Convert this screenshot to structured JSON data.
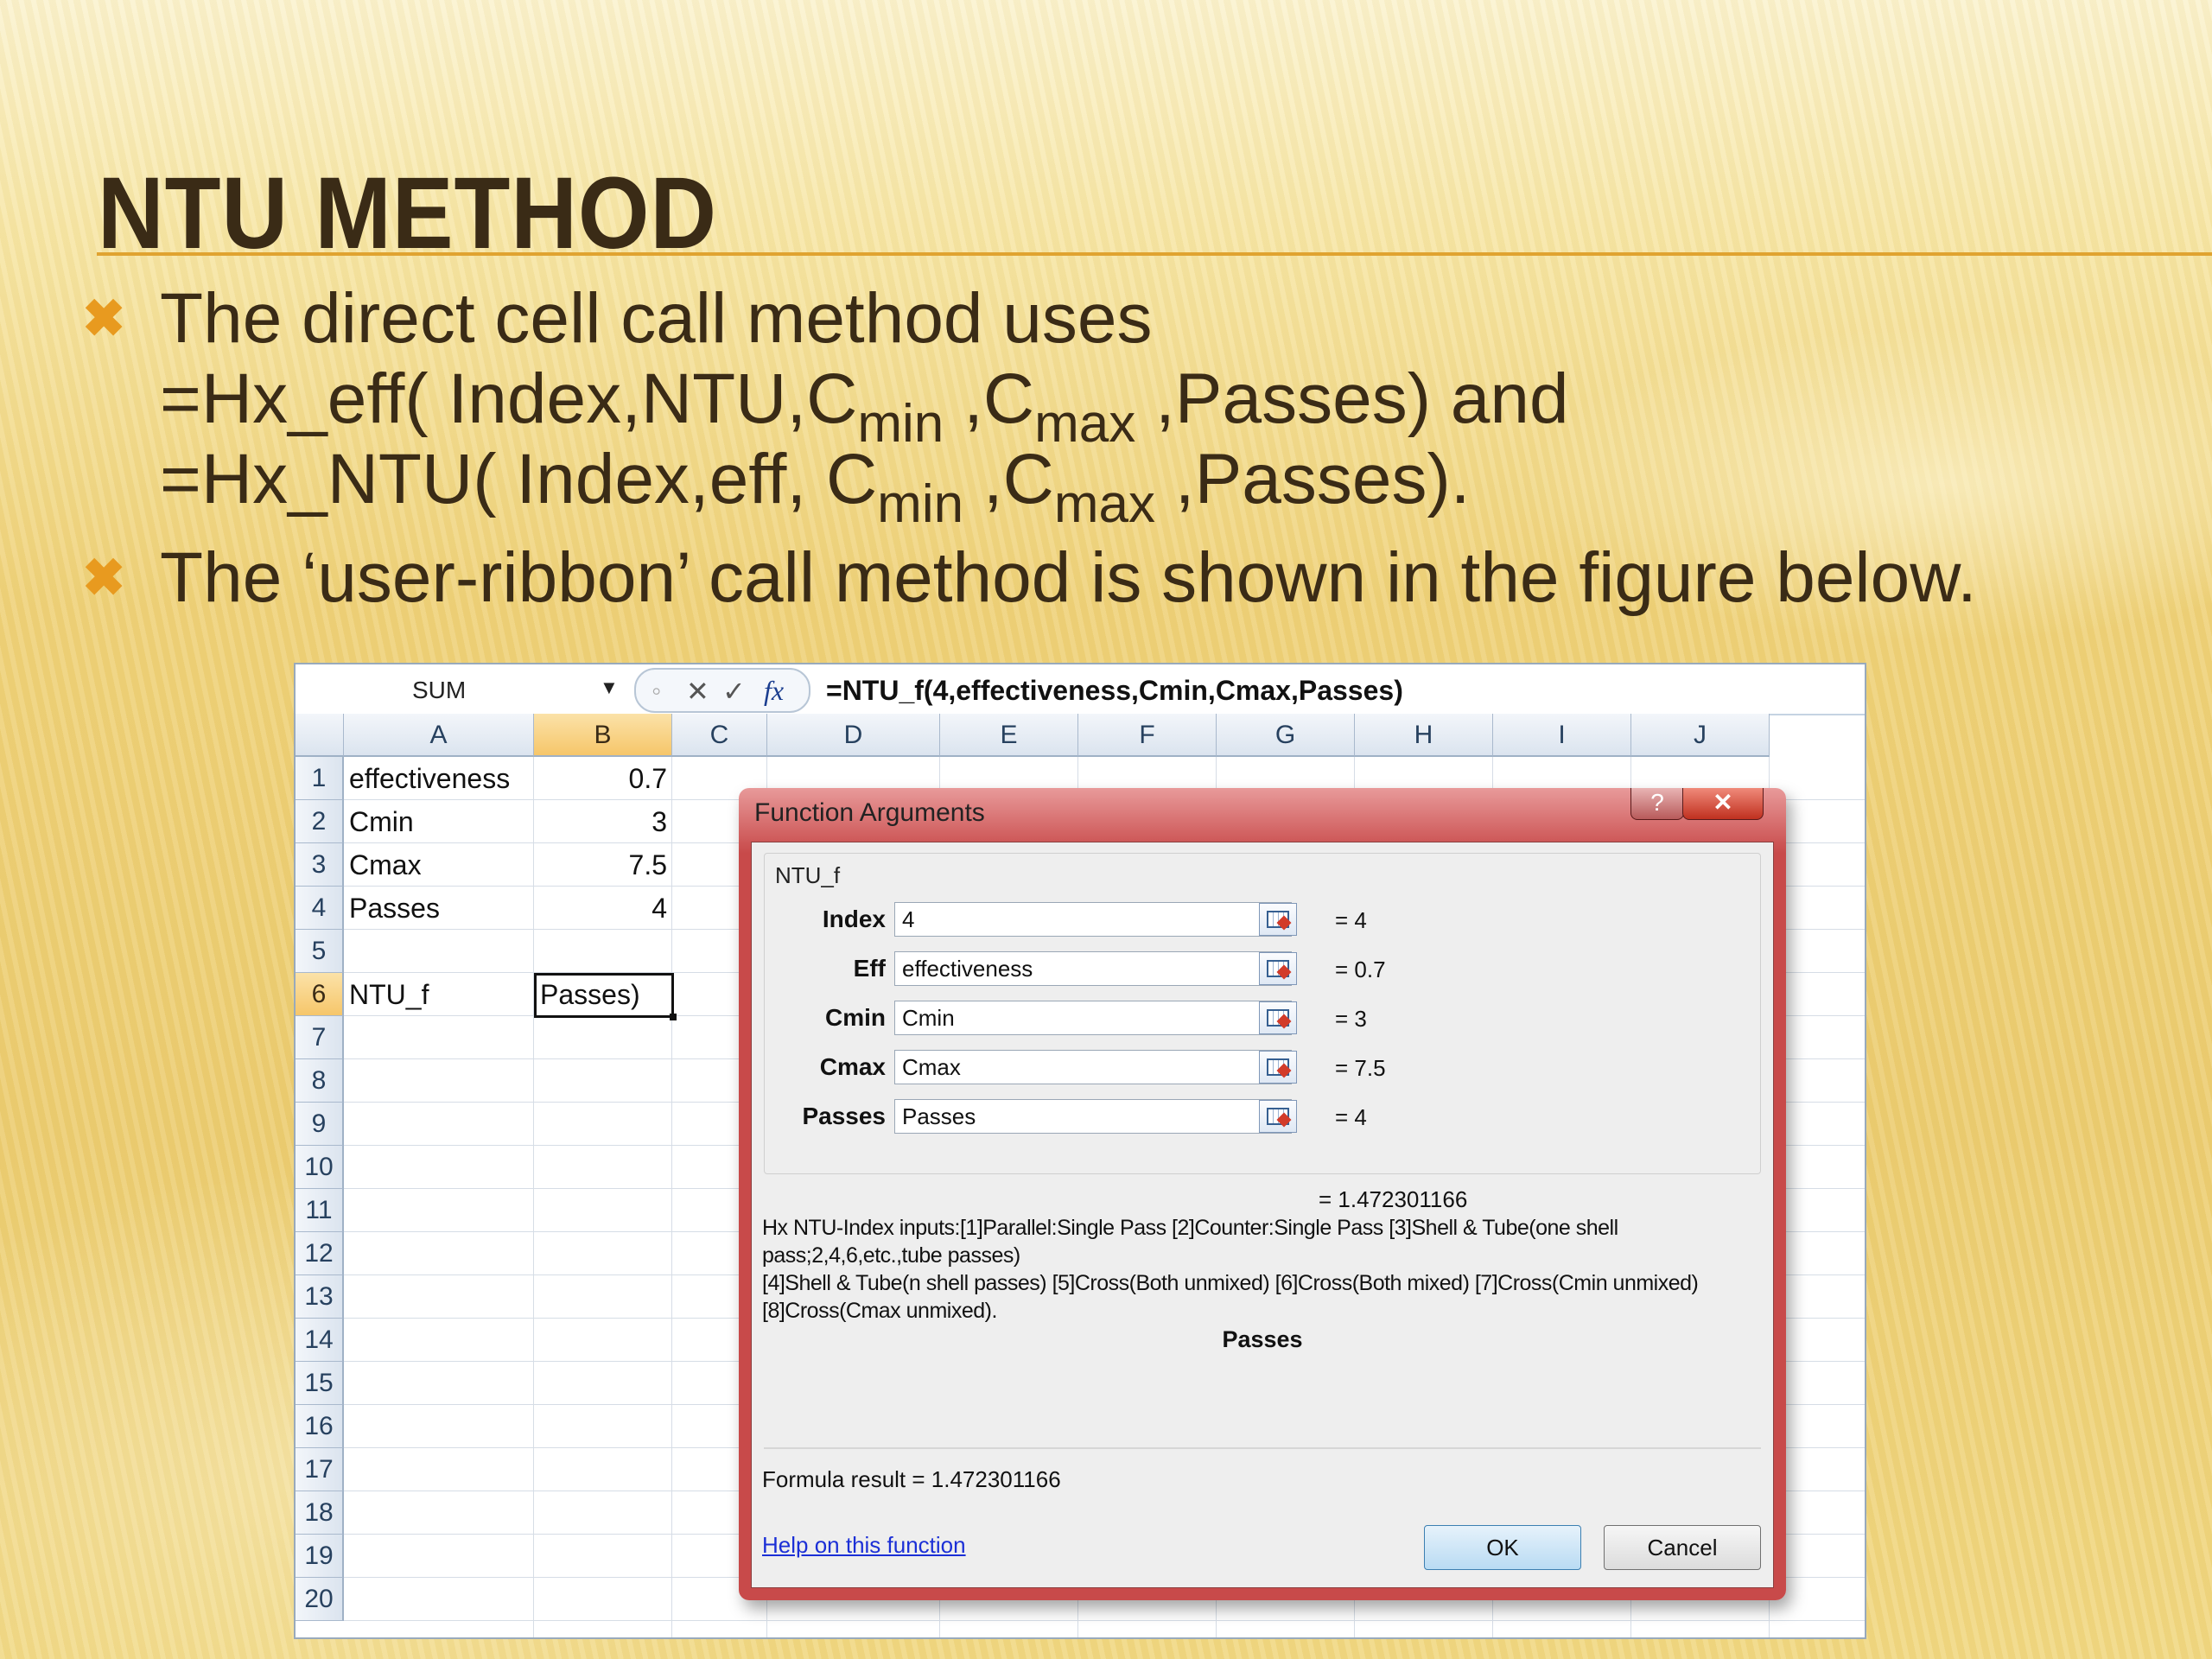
{
  "slide": {
    "title": "NTU METHOD",
    "bullet1": {
      "line1": "The direct cell call method uses",
      "f1_start": "=Hx_eff( Index,NTU,C",
      "f1_sub1": "min",
      "f1_mid": " ,C",
      "f1_sub2": "max",
      "f1_end": " ,Passes)",
      "f1_tail": " and",
      "f2_start": "=Hx_NTU( Index,eff, C",
      "f2_sub1": "min",
      "f2_mid": " ,C",
      "f2_sub2": "max",
      "f2_end": " ,Passes)."
    },
    "bullet2": "The ‘user-ribbon’ call method is shown in the figure below."
  },
  "excel": {
    "name_box": "SUM",
    "formula": "=NTU_f(4,effectiveness,Cmin,Cmax,Passes)",
    "columns": [
      "A",
      "B",
      "C",
      "D",
      "E",
      "F",
      "G",
      "H",
      "I",
      "J"
    ],
    "selected_column": "B",
    "rows": [
      "1",
      "2",
      "3",
      "4",
      "5",
      "6",
      "7",
      "8",
      "9",
      "10",
      "11",
      "12",
      "13",
      "14",
      "15",
      "16",
      "17",
      "18",
      "19",
      "20"
    ],
    "selected_row": "6",
    "cells": {
      "a1": "effectiveness",
      "b1": "0.7",
      "a2": "Cmin",
      "b2": "3",
      "a3": "Cmax",
      "b3": "7.5",
      "a4": "Passes",
      "b4": "4",
      "a6": "NTU_f",
      "b6": "Passes)"
    }
  },
  "dialog": {
    "title": "Function Arguments",
    "help_btn": "?",
    "close_btn": "✕",
    "function_name": "NTU_f",
    "args": [
      {
        "label": "Index",
        "value": "4",
        "result": "=  4"
      },
      {
        "label": "Eff",
        "value": "effectiveness",
        "result": "=  0.7"
      },
      {
        "label": "Cmin",
        "value": "Cmin",
        "result": "=  3"
      },
      {
        "label": "Cmax",
        "value": "Cmax",
        "result": "=  7.5"
      },
      {
        "label": "Passes",
        "value": "Passes",
        "result": "=  4"
      }
    ],
    "overall_result": "=    1.472301166",
    "description_1": "Hx NTU-Index inputs:[1]Parallel:Single Pass [2]Counter:Single Pass [3]Shell & Tube(one shell pass;2,4,6,etc.,tube passes)",
    "description_2": "[4]Shell & Tube(n shell passes) [5]Cross(Both unmixed) [6]Cross(Both mixed) [7]Cross(Cmin unmixed) [8]Cross(Cmax unmixed).",
    "arg_description": "Passes",
    "formula_result": "Formula result =    1.472301166",
    "help_link": "Help on this function",
    "ok": "OK",
    "cancel": "Cancel"
  }
}
